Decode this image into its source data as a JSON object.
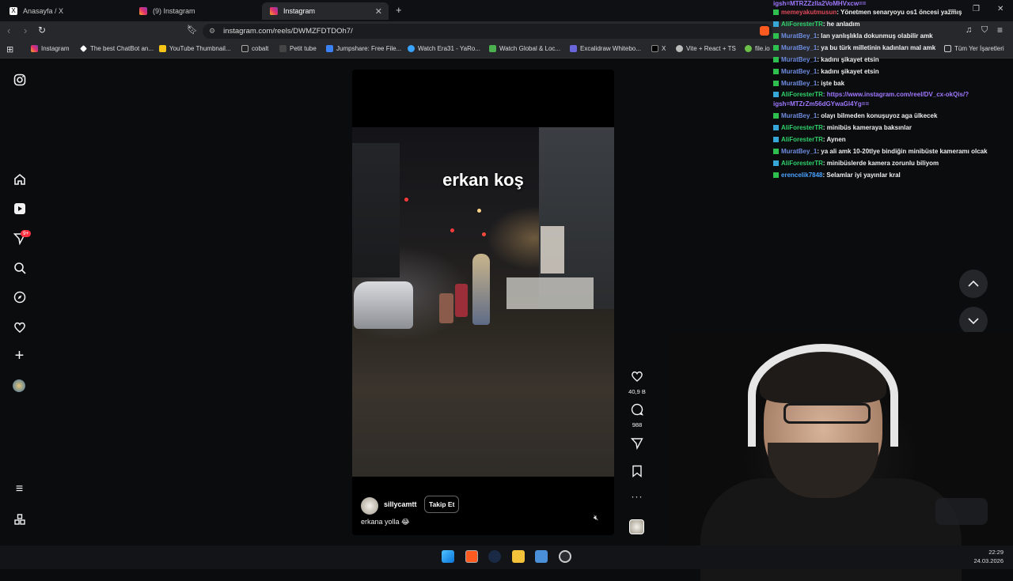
{
  "tabs": [
    {
      "label": "Anasayfa / X"
    },
    {
      "label": "(9) Instagram"
    },
    {
      "label": "Instagram",
      "active": true
    }
  ],
  "address_bar": {
    "url": "instagram.com/reels/DWMZFDTDOh7/"
  },
  "bookmarks": [
    "Instagram",
    "The best ChatBot an...",
    "YouTube Thumbnail...",
    "cobalt",
    "Petit tube",
    "Jumpshare: Free File...",
    "Watch Era31 - YaRo...",
    "Watch Global & Loc...",
    "Excalidraw Whitebo...",
    "X",
    "Vite + React + TS",
    "file.io",
    "Tüm Yer İşaretleri"
  ],
  "sidebar": {
    "notification_badge": "9+"
  },
  "reel": {
    "overlay_text": "erkan koş",
    "username": "sillycamtt",
    "follow_label": "Takip Et",
    "caption": "erkana yolla 😂",
    "likes": "40,9 B",
    "comments": "988"
  },
  "chat": [
    {
      "user": "",
      "text": "igsh=MTRZZzlla2VoMHVxcw==",
      "class": "link"
    },
    {
      "user": "memeyakutmusun",
      "text": ": Yönetmen senaryoyu os1 öncesi yazmış",
      "class": "u-mem"
    },
    {
      "user": "AliForesterTR",
      "text": ": he anladım",
      "class": "u-ali"
    },
    {
      "user": "MuratBey_1",
      "text": ": lan yanlışlıkla dokunmuş olabilir amk",
      "class": "u-murat"
    },
    {
      "user": "MuratBey_1",
      "text": ": ya bu türk milletinin kadınları mal amk",
      "class": "u-murat"
    },
    {
      "user": "MuratBey_1",
      "text": ": kadını şikayet etsin",
      "class": "u-murat"
    },
    {
      "user": "MuratBey_1",
      "text": ": kadını şikayet etsin",
      "class": "u-murat"
    },
    {
      "user": "MuratBey_1",
      "text": ": işte bak",
      "class": "u-murat"
    },
    {
      "user": "AliForesterTR",
      "text": ": https://www.instagram.com/reel/DV_cx-okQis/?",
      "class": "u-ali"
    },
    {
      "user": "",
      "text": "igsh=MTZrZm56dGYwaGl4Yg==",
      "class": "link"
    },
    {
      "user": "MuratBey_1",
      "text": ": olayı bilmeden konuşuyoz aga ülkecek",
      "class": "u-murat"
    },
    {
      "user": "AliForesterTR",
      "text": ": minibüs kameraya baksınlar",
      "class": "u-ali"
    },
    {
      "user": "AliForesterTR",
      "text": ": Aynen",
      "class": "u-ali"
    },
    {
      "user": "MuratBey_1",
      "text": ": ya ali amk 10-20tlye bindiğin minibüste kameramı olcak",
      "class": "u-murat"
    },
    {
      "user": "AliForesterTR",
      "text": ": minibüslerde kamera zorunlu biliyom",
      "class": "u-ali"
    },
    {
      "user": "erencelik7848",
      "text": ": Selamlar iyi yayınlar kral",
      "class": "u-eren"
    }
  ],
  "clock": {
    "time": "22:29",
    "date": "24.03.2026"
  },
  "colors": {
    "background": "#0b0c0e",
    "accent": "#ff3040",
    "link": "#9f79ff"
  }
}
